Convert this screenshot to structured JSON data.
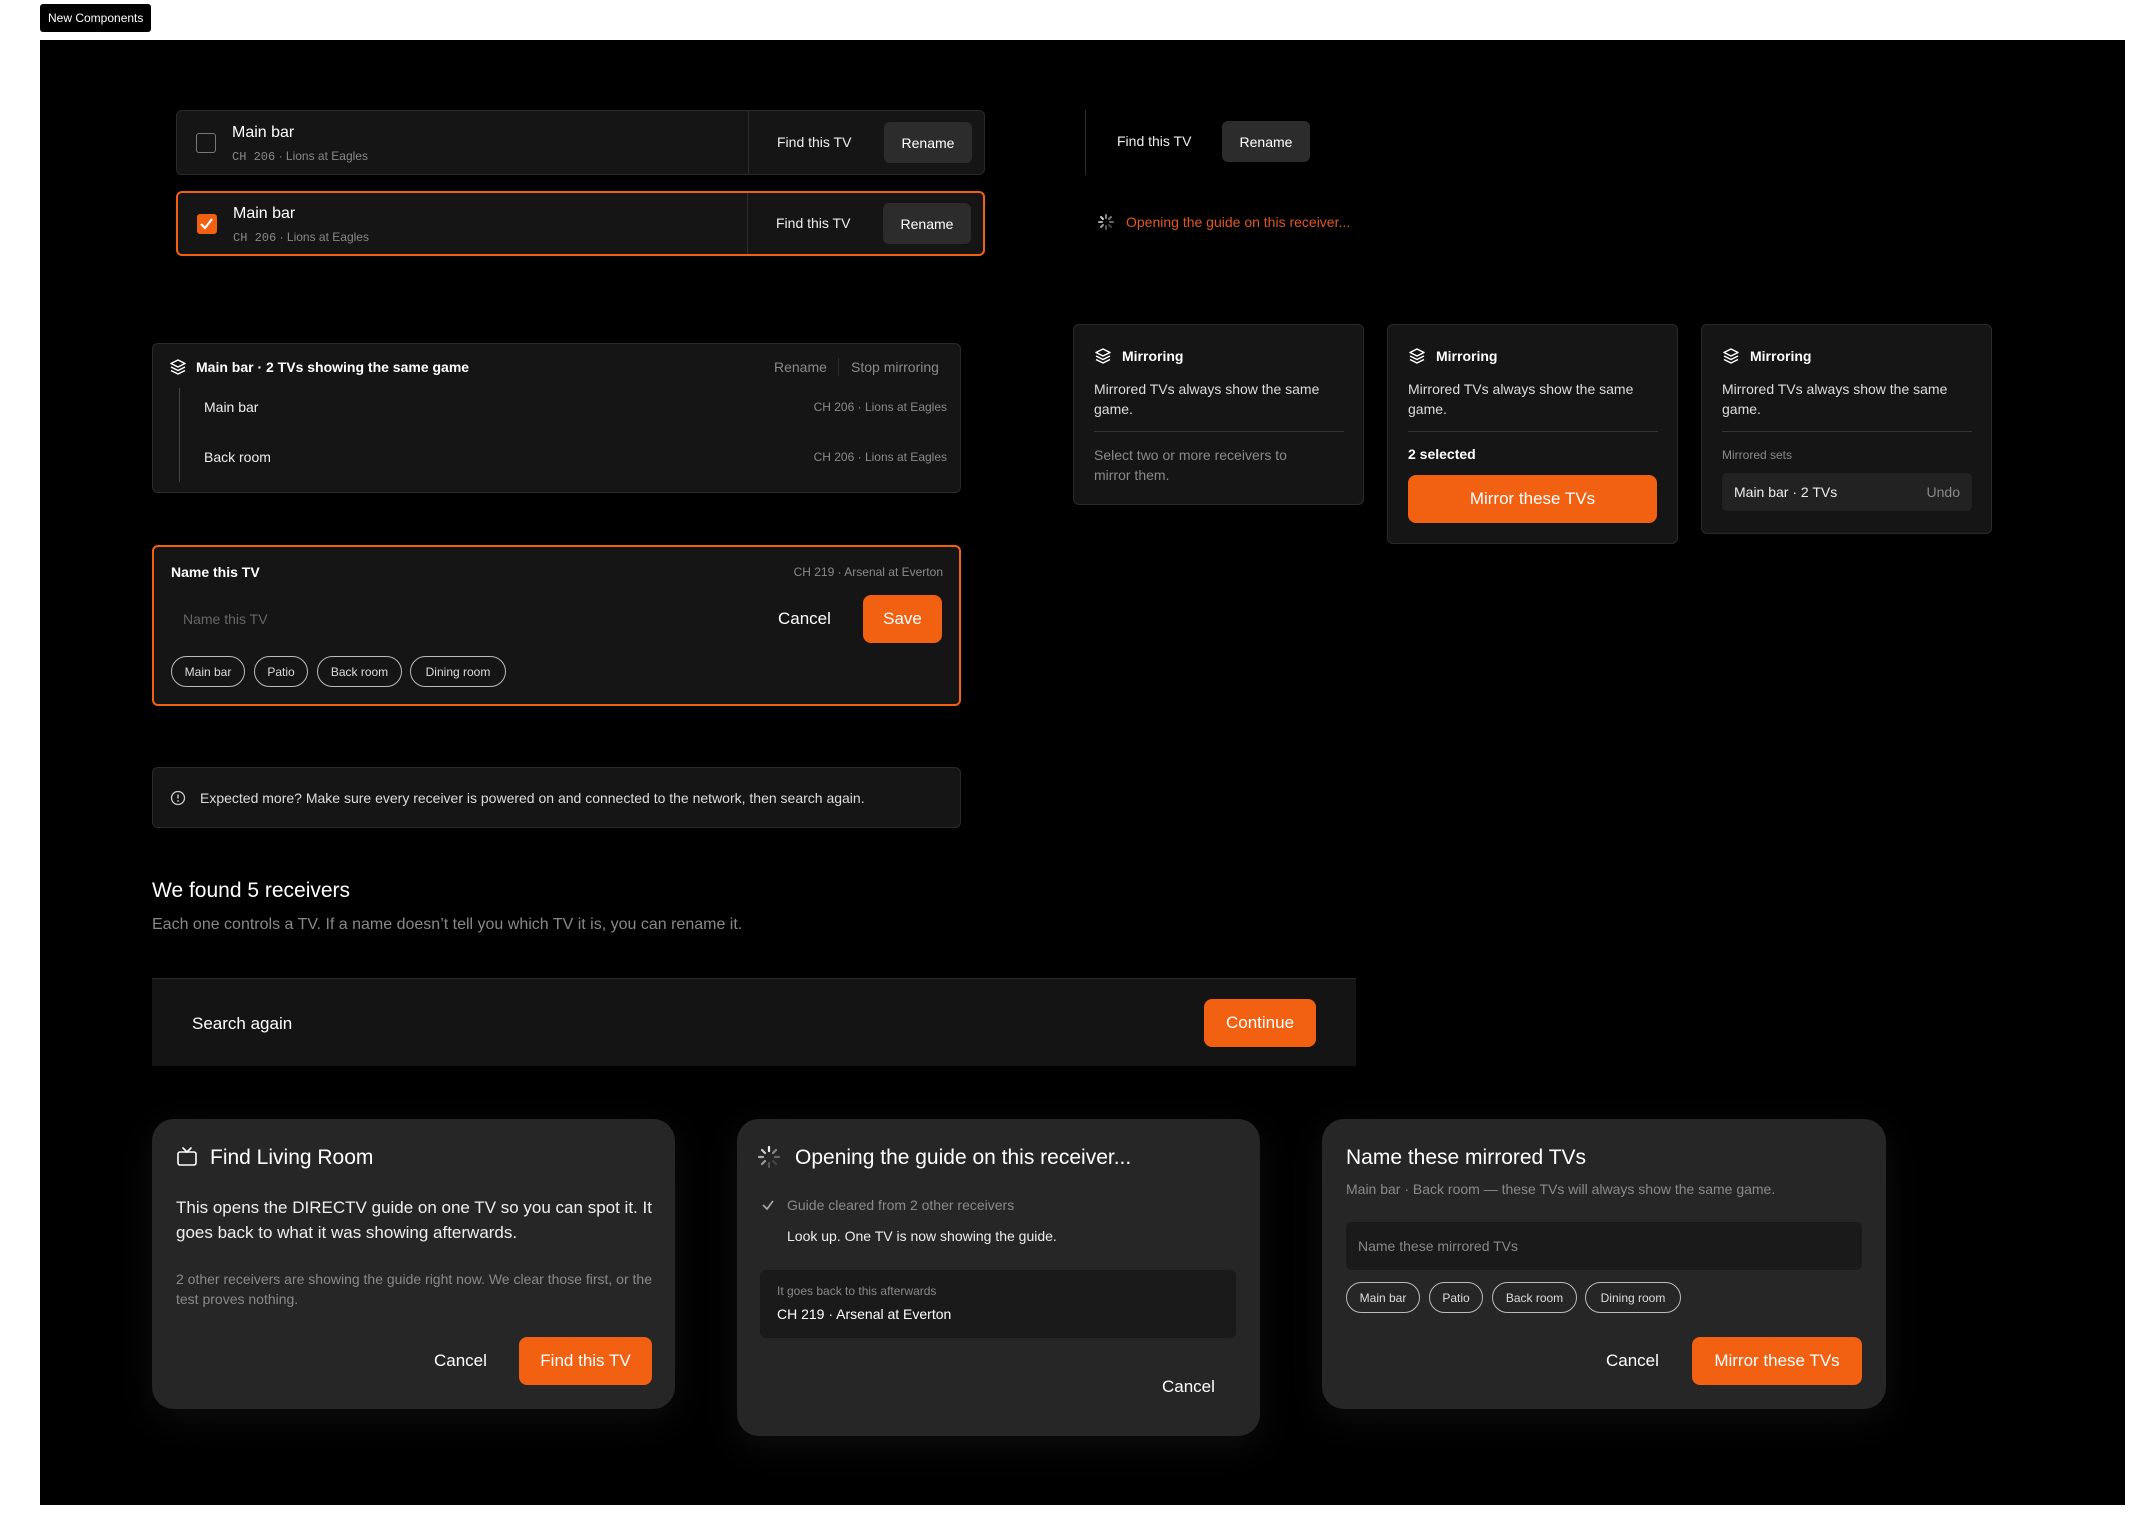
{
  "frame_label": "New Components",
  "receiver_rows": [
    {
      "name": "Main bar",
      "channel": "CH 206",
      "program": "Lions at Eagles",
      "find": "Find this TV",
      "rename": "Rename",
      "checked": false
    },
    {
      "name": "Main bar",
      "channel": "CH 206",
      "program": "Lions at Eagles",
      "find": "Find this TV",
      "rename": "Rename",
      "checked": true
    }
  ],
  "row_actions": {
    "find": "Find this TV",
    "rename": "Rename",
    "loading_text": "Opening the guide on this receiver..."
  },
  "mirror_group": {
    "title": "Main bar · 2 TVs showing the same game",
    "rename": "Rename",
    "stop": "Stop mirroring",
    "items": [
      {
        "name": "Main bar",
        "info": "CH 206 · Lions at Eagles"
      },
      {
        "name": "Back room",
        "info": "CH 206 · Lions at Eagles"
      }
    ]
  },
  "mirroring_cards": {
    "title": "Mirroring",
    "desc": "Mirrored TVs always show the same game.",
    "empty_hint": "Select two or more receivers to mirror them.",
    "selected": "2 selected",
    "mirror_button": "Mirror these TVs",
    "sets_label": "Mirrored sets",
    "set_name": "Main bar · 2 TVs",
    "undo": "Undo"
  },
  "name_editor": {
    "title": "Name this TV",
    "info": "CH 219 · Arsenal at Everton",
    "placeholder": "Name this TV",
    "cancel": "Cancel",
    "save": "Save",
    "chips": [
      "Main bar",
      "Patio",
      "Back room",
      "Dining room"
    ]
  },
  "notice": "Expected more? Make sure every receiver is powered on and connected to the network, then search again.",
  "found": {
    "title": "We found 5 receivers",
    "subtitle": "Each one controls a TV. If a name doesn’t tell you which TV it is, you can rename it."
  },
  "footer_bar": {
    "search_again": "Search again",
    "continue": "Continue"
  },
  "modal_find": {
    "title": "Find Living Room",
    "body": "This opens the DIRECTV guide on one TV so you can spot it. It goes back to what it was showing afterwards.",
    "note": "2 other receivers are showing the guide right now. We clear those first, or the test proves nothing.",
    "cancel": "Cancel",
    "confirm": "Find this TV"
  },
  "modal_opening": {
    "title": "Opening the guide on this receiver...",
    "step_done": "Guide cleared from 2 other receivers",
    "step_now": "Look up. One TV is now showing the guide.",
    "back_label": "It goes back to this afterwards",
    "back_value": "CH 219 · Arsenal at Everton",
    "cancel": "Cancel"
  },
  "modal_name_mirrored": {
    "title": "Name these mirrored TVs",
    "subtitle": "Main bar · Back room — these TVs will always show the same game.",
    "placeholder": "Name these mirrored TVs",
    "chips": [
      "Main bar",
      "Patio",
      "Back room",
      "Dining room"
    ],
    "cancel": "Cancel",
    "confirm": "Mirror these TVs"
  },
  "colors": {
    "accent": "#f26012",
    "background": "#000000",
    "surface": "#151515",
    "modal": "#262626"
  }
}
